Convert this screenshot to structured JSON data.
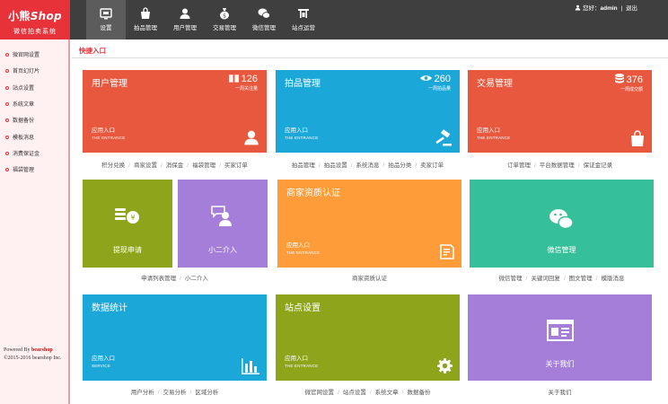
{
  "app": {
    "logo_line1a": "小熊",
    "logo_line1b": "Shop",
    "logo_line2": "微信拍卖系统"
  },
  "topnav": [
    {
      "label": "设置",
      "icon": "settings-icon"
    },
    {
      "label": "拍品管理",
      "icon": "bag-icon"
    },
    {
      "label": "用户管理",
      "icon": "user-icon"
    },
    {
      "label": "交易管理",
      "icon": "money-bag-icon"
    },
    {
      "label": "微信管理",
      "icon": "wechat-icon"
    },
    {
      "label": "站点运营",
      "icon": "site-icon"
    }
  ],
  "user": {
    "greeting": "您好：",
    "name": "admin",
    "separator": "|",
    "logout": "退出"
  },
  "sidebar": {
    "items": [
      "微官网设置",
      "首页幻灯片",
      "站点设置",
      "系统文章",
      "数据备份",
      "模板消息",
      "消费保证金",
      "福袋管理"
    ]
  },
  "powered": {
    "prefix": "Powered By ",
    "brand": "bearshop",
    "copyright": "©2015-2016 bearshop Inc."
  },
  "page": {
    "title": "快捷入口"
  },
  "colors": {
    "red": "#e8583e",
    "blue": "#1ba8d8",
    "green": "#8ea51b",
    "purple": "#a47ed9",
    "orange": "#fd9c39",
    "teal": "#36c09a",
    "header": "#3f3f3f",
    "accent": "#e8323a"
  },
  "tiles": {
    "user": {
      "title": "用户管理",
      "count": "126",
      "count_label": "一周关注量",
      "entry": "应用入口",
      "entry_en": "THE ENTRANCE"
    },
    "auction": {
      "title": "拍品管理",
      "count": "260",
      "count_label": "一周拍品量",
      "entry": "应用入口",
      "entry_en": "THE ENTRANCE"
    },
    "trade": {
      "title": "交易管理",
      "count": "376",
      "count_label": "一周成交额",
      "entry": "应用入口",
      "entry_en": "THE ENTRANCE"
    },
    "withdraw": {
      "title": "提现申请"
    },
    "agent": {
      "title": "小二介入"
    },
    "merchant": {
      "title": "商家资质认证",
      "entry": "应用入口",
      "entry_en": "THE ENTRANCE"
    },
    "wechat": {
      "title": "微信管理"
    },
    "stats": {
      "title": "数据统计",
      "entry": "应用入口",
      "entry_en": "SERVICE"
    },
    "site": {
      "title": "站点设置",
      "entry": "应用入口",
      "entry_en": "THE ENTRANCE"
    },
    "about": {
      "title": "关于我们"
    }
  },
  "links": {
    "user": [
      "积分兑换",
      "商家设置",
      "消保金",
      "福袋管理",
      "买家订单"
    ],
    "auction": [
      "拍品管理",
      "拍品设置",
      "系统消息",
      "拍品分类",
      "卖家订单"
    ],
    "trade": [
      "订单管理",
      "平台数据管理",
      "保证金记录"
    ],
    "withdraw": [
      "申请列表管理",
      "小二介入"
    ],
    "merchant": [
      "商家资质认证"
    ],
    "wechat": [
      "微信管理",
      "关键词回复",
      "图文管理",
      "模版消息"
    ],
    "stats": [
      "用户分析",
      "交易分析",
      "区域分析"
    ],
    "site": [
      "微官网设置",
      "站点设置",
      "系统文章",
      "数据备份"
    ],
    "about": [
      "关于我们"
    ]
  }
}
